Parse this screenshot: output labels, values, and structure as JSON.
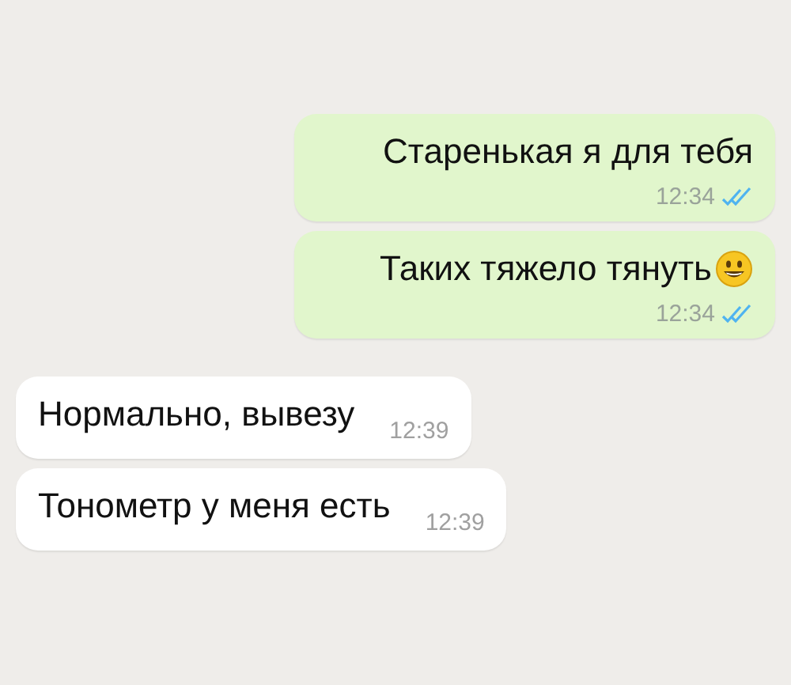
{
  "messages": [
    {
      "kind": "outgoing",
      "text": "Старенькая я для тебя",
      "has_emoji": false,
      "time": "12:34",
      "read": true
    },
    {
      "kind": "outgoing",
      "text": "Таких тяжело тянуть",
      "has_emoji": true,
      "time": "12:34",
      "read": true
    },
    {
      "kind": "incoming",
      "text": "Нормально, вывезу",
      "time": "12:39"
    },
    {
      "kind": "incoming",
      "text": "Тонометр у меня есть",
      "time": "12:39"
    }
  ]
}
